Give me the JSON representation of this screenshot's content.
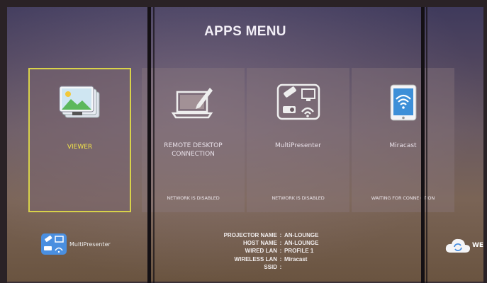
{
  "menu": {
    "title": "APPS MENU"
  },
  "tiles": [
    {
      "label": "VIEWER",
      "status": ""
    },
    {
      "label": "REMOTE DESKTOP CONNECTION",
      "status": "NETWORK IS DISABLED"
    },
    {
      "label": "MultiPresenter",
      "status": "NETWORK IS DISABLED"
    },
    {
      "label": "Miracast",
      "status": "WAITING FOR CONNE CTION"
    }
  ],
  "bottom_app": {
    "label": "MultiPresenter"
  },
  "info": [
    {
      "key": "PROJECTOR NAME",
      "value": "AN-LOUNGE"
    },
    {
      "key": "HOST NAME",
      "value": "AN-LOUNGE"
    },
    {
      "key": "WIRED LAN",
      "value": "PROFILE 1"
    },
    {
      "key": "WIRELESS LAN",
      "value": "Miracast"
    },
    {
      "key": "SSID",
      "value": ""
    }
  ],
  "cloud": {
    "label": "WE"
  },
  "colors": {
    "selection": "#d8d24a",
    "accent": "#4a8fe0"
  }
}
